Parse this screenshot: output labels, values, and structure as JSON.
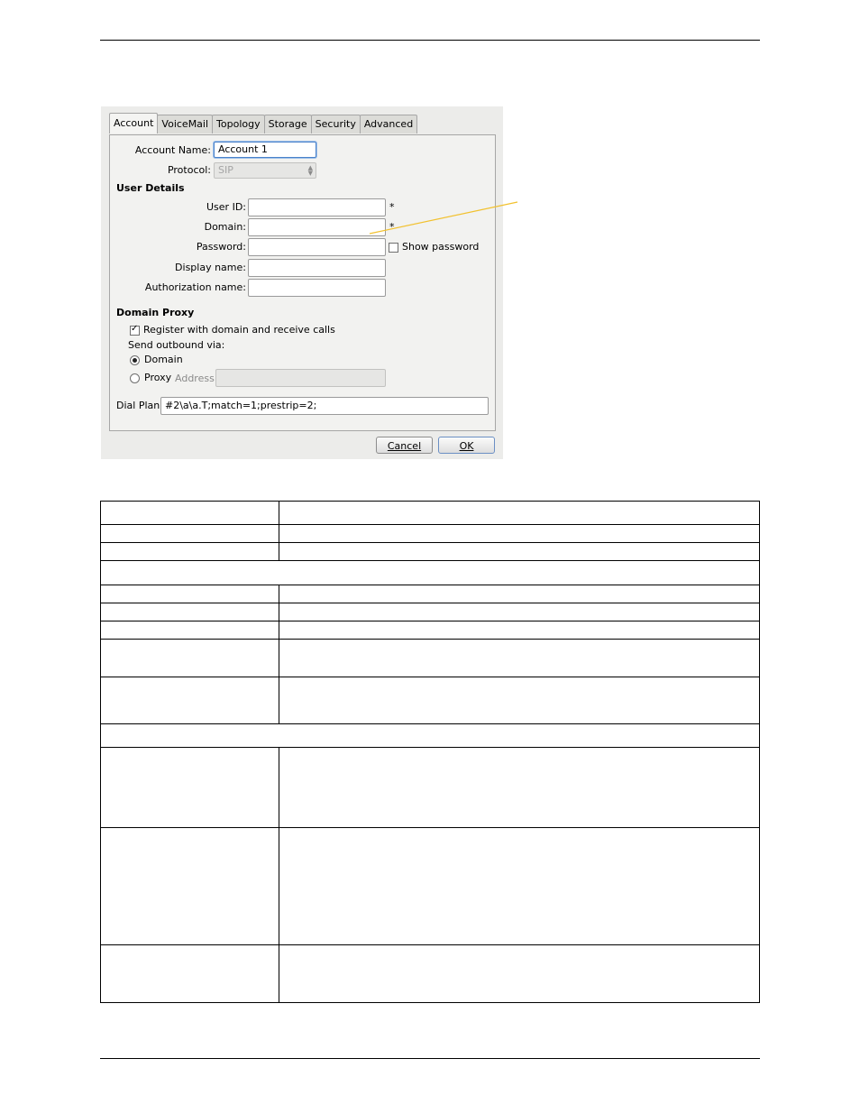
{
  "dialog": {
    "tabs": [
      "Account",
      "VoiceMail",
      "Topology",
      "Storage",
      "Security",
      "Advanced"
    ],
    "active_tab": "Account",
    "account_name": {
      "label": "Account Name:",
      "value": "Account 1"
    },
    "protocol": {
      "label": "Protocol:",
      "value": "SIP"
    },
    "user_details": {
      "heading": "User Details",
      "user_id_label": "User ID:",
      "domain_label": "Domain:",
      "password_label": "Password:",
      "display_name_label": "Display name:",
      "authorization_name_label": "Authorization name:",
      "required_mark": "*",
      "show_password_label": "Show password",
      "show_password_checked": false
    },
    "domain_proxy": {
      "heading": "Domain Proxy",
      "register_label": "Register with domain and receive calls",
      "register_checked": true,
      "send_outbound_label": "Send outbound via:",
      "domain_option": "Domain",
      "proxy_option": "Proxy",
      "selected": "Domain",
      "address_label": "Address:"
    },
    "dial_plan": {
      "label": "Dial Plan:",
      "value": "#2\\a\\a.T;match=1;prestrip=2;"
    },
    "buttons": {
      "cancel": "Cancel",
      "ok": "OK"
    }
  },
  "colors": {
    "callout_line": "#f2c12e",
    "dialog_bg": "#ececea"
  }
}
